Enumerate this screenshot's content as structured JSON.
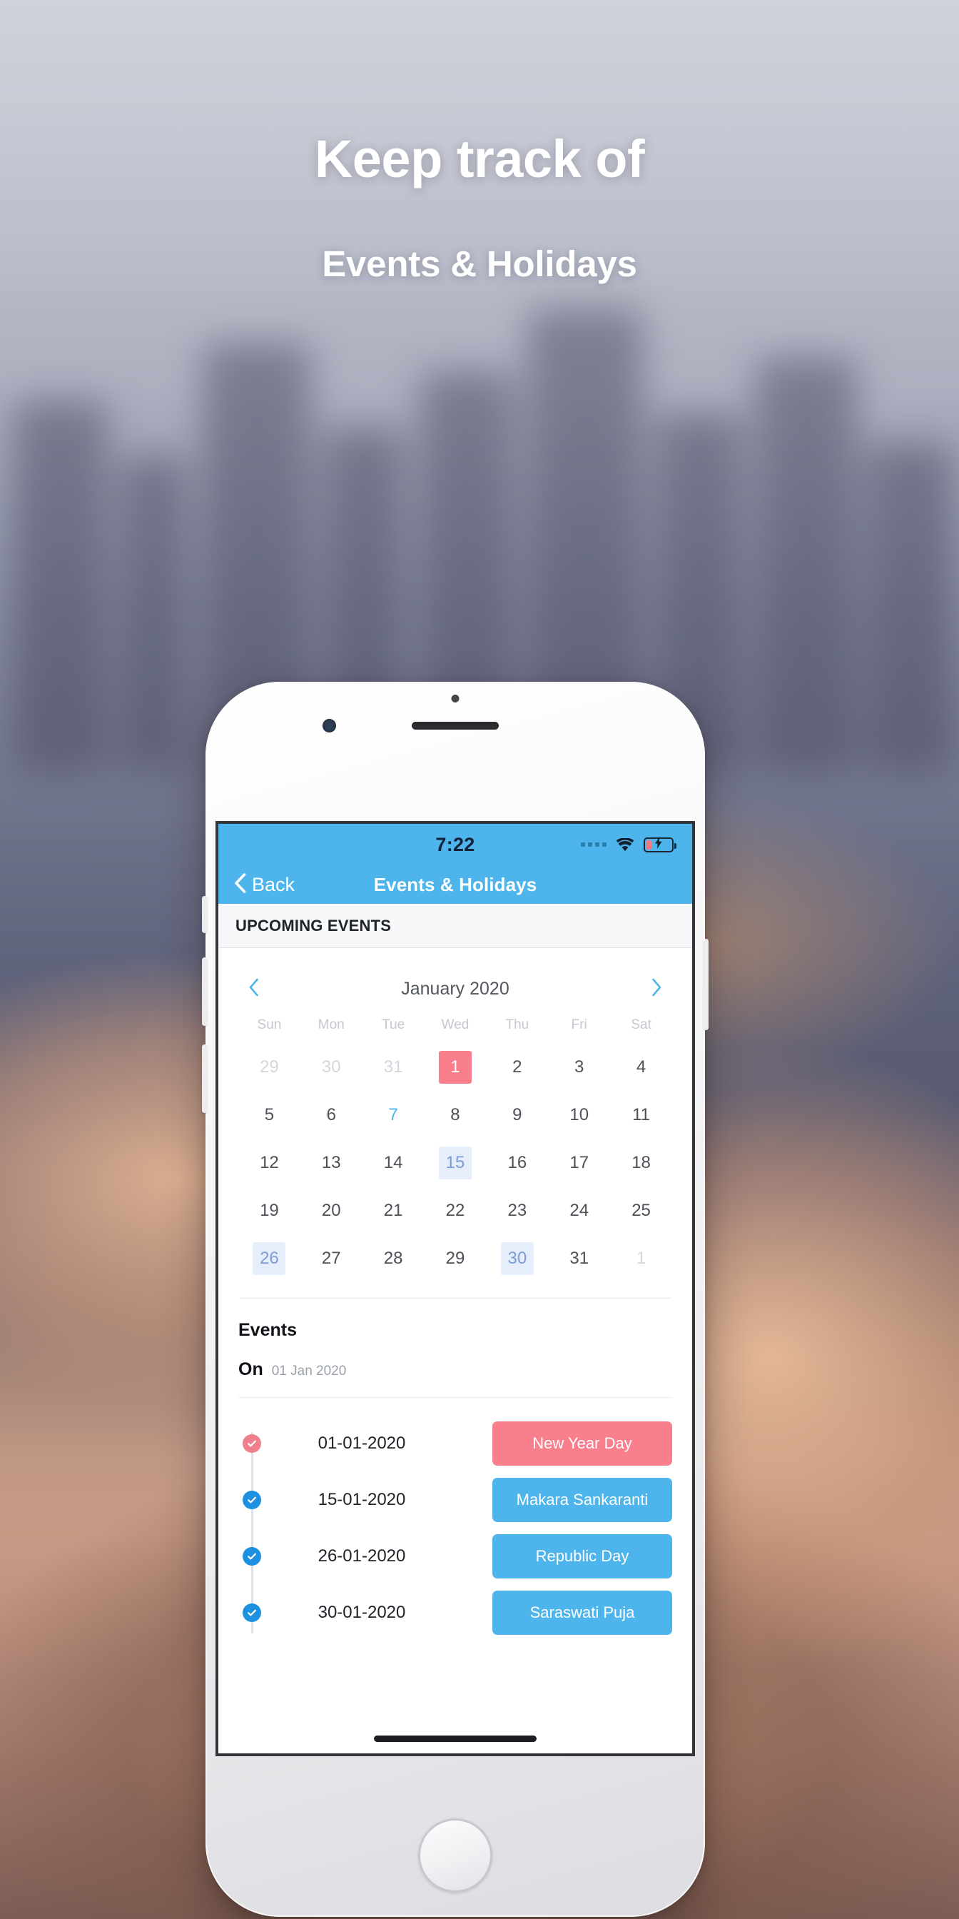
{
  "hero": {
    "line1": "Keep track of",
    "line2": "Events & Holidays"
  },
  "phone": {
    "statusbar": {
      "time": "7:22",
      "signal_icon": "signal-dots-icon",
      "wifi_icon": "wifi-icon",
      "battery_icon": "battery-charging-icon"
    },
    "navbar": {
      "back_icon": "chevron-left-icon",
      "back_label": "Back",
      "title": "Events & Holidays"
    },
    "section": {
      "label": "UPCOMING EVENTS"
    },
    "calendar": {
      "prev_icon": "chevron-left-icon",
      "next_icon": "chevron-right-icon",
      "month_label": "January 2020",
      "weekdays": [
        "Sun",
        "Mon",
        "Tue",
        "Wed",
        "Thu",
        "Fri",
        "Sat"
      ],
      "cells": [
        {
          "d": "29",
          "state": "muted"
        },
        {
          "d": "30",
          "state": "muted"
        },
        {
          "d": "31",
          "state": "muted"
        },
        {
          "d": "1",
          "state": "sel-red"
        },
        {
          "d": "2",
          "state": "normal"
        },
        {
          "d": "3",
          "state": "normal"
        },
        {
          "d": "4",
          "state": "normal"
        },
        {
          "d": "5",
          "state": "normal"
        },
        {
          "d": "6",
          "state": "normal"
        },
        {
          "d": "7",
          "state": "today"
        },
        {
          "d": "8",
          "state": "normal"
        },
        {
          "d": "9",
          "state": "normal"
        },
        {
          "d": "10",
          "state": "normal"
        },
        {
          "d": "11",
          "state": "normal"
        },
        {
          "d": "12",
          "state": "normal"
        },
        {
          "d": "13",
          "state": "normal"
        },
        {
          "d": "14",
          "state": "normal"
        },
        {
          "d": "15",
          "state": "sel-blue"
        },
        {
          "d": "16",
          "state": "normal"
        },
        {
          "d": "17",
          "state": "normal"
        },
        {
          "d": "18",
          "state": "normal"
        },
        {
          "d": "19",
          "state": "normal"
        },
        {
          "d": "20",
          "state": "normal"
        },
        {
          "d": "21",
          "state": "normal"
        },
        {
          "d": "22",
          "state": "normal"
        },
        {
          "d": "23",
          "state": "normal"
        },
        {
          "d": "24",
          "state": "normal"
        },
        {
          "d": "25",
          "state": "normal"
        },
        {
          "d": "26",
          "state": "sel-blue"
        },
        {
          "d": "27",
          "state": "normal"
        },
        {
          "d": "28",
          "state": "normal"
        },
        {
          "d": "29",
          "state": "normal"
        },
        {
          "d": "30",
          "state": "sel-blue"
        },
        {
          "d": "31",
          "state": "normal"
        },
        {
          "d": "1",
          "state": "muted"
        }
      ]
    },
    "events": {
      "title": "Events",
      "on_label": "On",
      "on_date": "01 Jan 2020",
      "rows": [
        {
          "date": "01-01-2020",
          "name": "New Year Day",
          "color": "red",
          "dot_icon": "check-circle-icon"
        },
        {
          "date": "15-01-2020",
          "name": "Makara Sankaranti",
          "color": "blue",
          "dot_icon": "check-circle-icon"
        },
        {
          "date": "26-01-2020",
          "name": "Republic Day",
          "color": "blue",
          "dot_icon": "check-circle-icon"
        },
        {
          "date": "30-01-2020",
          "name": "Saraswati Puja",
          "color": "blue",
          "dot_icon": "check-circle-icon"
        }
      ]
    }
  },
  "colors": {
    "brand_blue": "#4db5ec",
    "accent_red": "#f97f8d",
    "selected_blue_bg": "#e6eefb",
    "selected_blue_text": "#7d9cd4"
  }
}
